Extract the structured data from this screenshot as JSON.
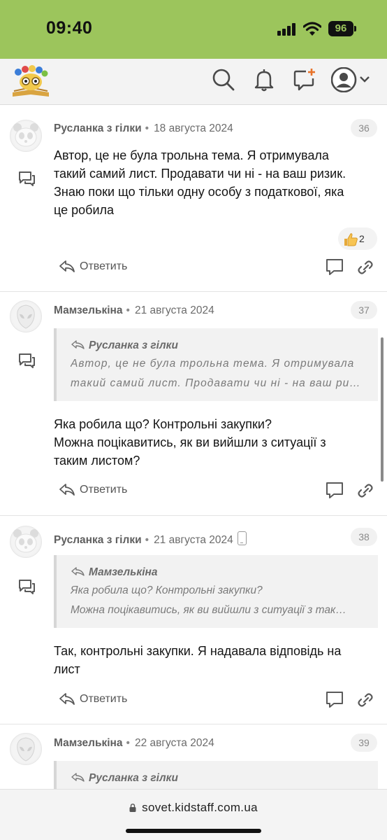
{
  "status_bar": {
    "time": "09:40",
    "battery": "96"
  },
  "site": {
    "url": "sovet.kidstaff.com.ua"
  },
  "actions": {
    "reply_label": "Ответить"
  },
  "posts": [
    {
      "author": "Русланка з гілки",
      "date": "18 августа 2024",
      "number": "36",
      "avatar": "panda-avatar",
      "body": [
        "Автор, це не була трольна тема. Я отримувала",
        "такий самий лист. Продавати чи ні - на ваш ризик.",
        "Знаю поки що тільки одну особу з податкової, яка",
        "це робила"
      ],
      "reaction": {
        "icon": "thumbs-up",
        "count": "2"
      }
    },
    {
      "author": "Мамзелькіна",
      "date": "21 августа 2024",
      "number": "37",
      "avatar": "alien-avatar",
      "quote": {
        "author": "Русланка з гілки",
        "lines": [
          "Автор, це не була трольна тема. Я отримувала",
          "такий самий лист. Продавати чи ні - на ваш ризик"
        ]
      },
      "body": [
        "Яка робила що? Контрольні закупки?",
        "Можна поцікавитись, як ви вийшли з ситуації з",
        "таким листом?"
      ]
    },
    {
      "author": "Русланка з гілки",
      "date": "21 августа 2024",
      "number": "38",
      "avatar": "panda-avatar",
      "mobile": true,
      "quote": {
        "author": "Мамзелькіна",
        "lines": [
          "Яка робила що? Контрольні закупки?",
          "Можна поцікавитись, як ви вийшли з ситуації з так…"
        ]
      },
      "body": [
        "Так, контрольні закупки. Я надавала відповідь на",
        "лист"
      ]
    },
    {
      "author": "Мамзелькіна",
      "date": "22 августа 2024",
      "number": "39",
      "avatar": "alien-avatar",
      "quote": {
        "author": "Русланка з гілки",
        "lines": []
      }
    }
  ],
  "colors": {
    "status_bar": "#9cc55c",
    "header": "#f3f3f3",
    "quote_bg": "#f2f2f2",
    "text": "#141414",
    "muted": "#6b6b6b"
  }
}
